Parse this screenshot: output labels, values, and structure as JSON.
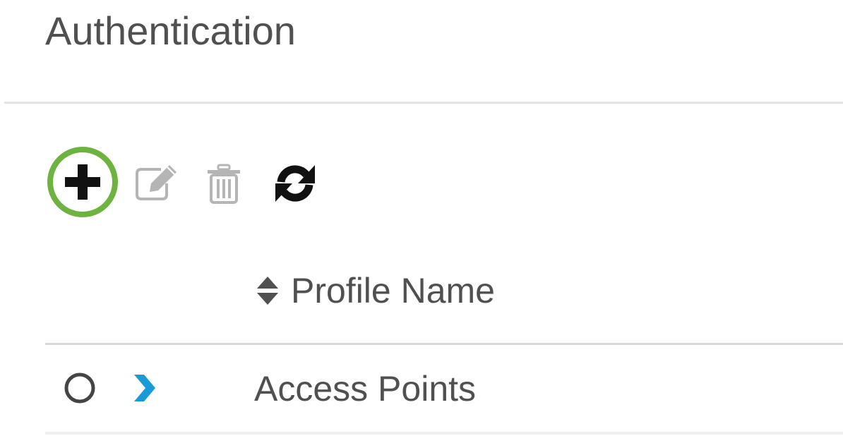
{
  "page": {
    "title": "Authentication"
  },
  "toolbar": {
    "add_icon": "plus-circle-icon",
    "edit_icon": "edit-icon",
    "delete_icon": "trash-icon",
    "refresh_icon": "refresh-icon",
    "highlight_color": "#6db33f"
  },
  "table": {
    "columns": [
      {
        "label": "Profile Name",
        "sort_icon": "sort-icon"
      }
    ],
    "rows": [
      {
        "profile_name": "Access Points",
        "selected": false,
        "expanded": false
      }
    ]
  },
  "colors": {
    "text": "#505050",
    "accent": "#1a9ad6",
    "icon_dark": "#111111",
    "icon_disabled": "#b5b5b5",
    "divider": "#e4e4e4"
  }
}
